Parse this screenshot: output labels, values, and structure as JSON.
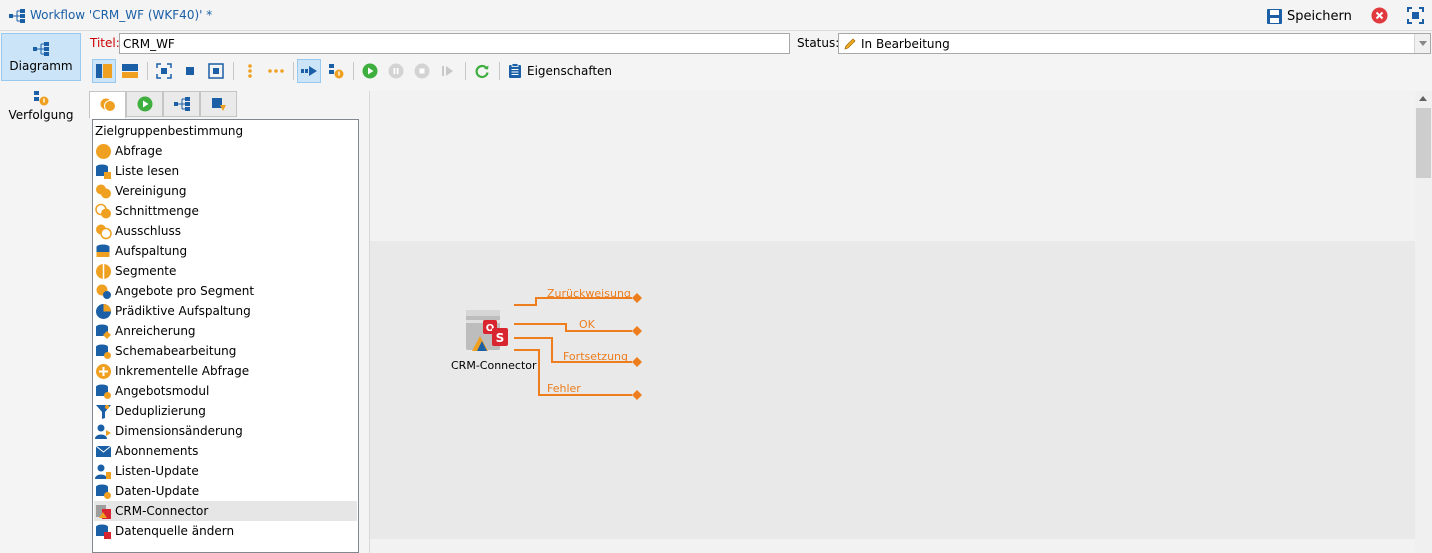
{
  "window": {
    "title": "Workflow 'CRM_WF (WKF40)' *",
    "save_label": "Speichern"
  },
  "nav": {
    "items": [
      {
        "label": "Diagramm"
      },
      {
        "label": "Verfolgung"
      }
    ]
  },
  "form": {
    "title_label": "Titel:",
    "title_value": "CRM_WF",
    "status_label": "Status:",
    "status_value": "In Bearbeitung"
  },
  "toolbar": {
    "properties_label": "Eigenschaften"
  },
  "palette": {
    "group": "Zielgruppenbestimmung",
    "items": [
      {
        "label": "Abfrage"
      },
      {
        "label": "Liste lesen"
      },
      {
        "label": "Vereinigung"
      },
      {
        "label": "Schnittmenge"
      },
      {
        "label": "Ausschluss"
      },
      {
        "label": "Aufspaltung"
      },
      {
        "label": "Segmente"
      },
      {
        "label": "Angebote pro Segment"
      },
      {
        "label": "Prädiktive Aufspaltung"
      },
      {
        "label": "Anreicherung"
      },
      {
        "label": "Schemabearbeitung"
      },
      {
        "label": "Inkrementelle Abfrage"
      },
      {
        "label": "Angebotsmodul"
      },
      {
        "label": "Deduplizierung"
      },
      {
        "label": "Dimensionsänderung"
      },
      {
        "label": "Abonnements"
      },
      {
        "label": "Listen-Update"
      },
      {
        "label": "Daten-Update"
      },
      {
        "label": "CRM-Connector"
      },
      {
        "label": "Datenquelle ändern"
      }
    ]
  },
  "diagram": {
    "node_label": "CRM-Connector",
    "outputs": [
      {
        "label": "Zurückweisung"
      },
      {
        "label": "OK"
      },
      {
        "label": "Fortsetzung"
      },
      {
        "label": "Fehler"
      }
    ]
  },
  "colors": {
    "accent": "#1b5fa7",
    "transition": "#ed7d1d",
    "selection": "#cce4f7",
    "required_label": "#cc0000"
  }
}
